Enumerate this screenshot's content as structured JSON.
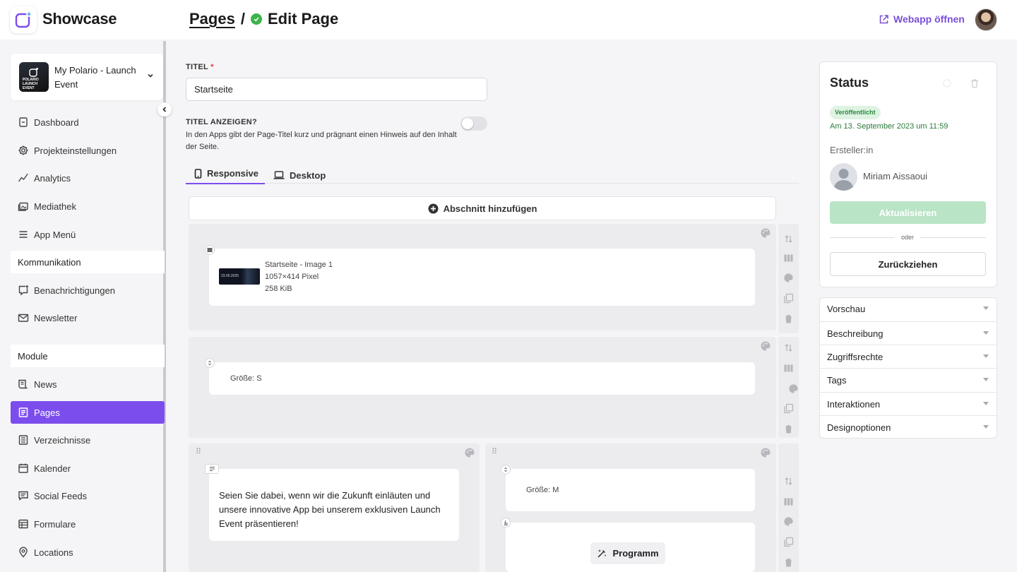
{
  "header": {
    "brand": "Showcase",
    "breadcrumb_link": "Pages",
    "breadcrumb_sep": "/",
    "breadcrumb_current": "Edit Page",
    "webapp_link": "Webapp öffnen"
  },
  "sidebar": {
    "project": {
      "name": "My Polario - Launch Event",
      "thumb_text": "POLARIO LAUNCH EVENT"
    },
    "items": [
      {
        "label": "Dashboard",
        "icon": "dashboard-icon"
      },
      {
        "label": "Projekteinstellungen",
        "icon": "gear-icon"
      },
      {
        "label": "Analytics",
        "icon": "analytics-icon"
      },
      {
        "label": "Mediathek",
        "icon": "media-library-icon"
      },
      {
        "label": "App Menü",
        "icon": "menu-icon"
      }
    ],
    "section_kommunikation": "Kommunikation",
    "items_kommunikation": [
      {
        "label": "Benachrichtigungen",
        "icon": "notification-icon"
      },
      {
        "label": "Newsletter",
        "icon": "mail-icon"
      }
    ],
    "section_module": "Module",
    "items_module": [
      {
        "label": "News",
        "icon": "news-icon"
      },
      {
        "label": "Pages",
        "icon": "page-icon",
        "active": true
      },
      {
        "label": "Verzeichnisse",
        "icon": "directory-icon"
      },
      {
        "label": "Kalender",
        "icon": "calendar-icon"
      },
      {
        "label": "Social Feeds",
        "icon": "social-feed-icon"
      },
      {
        "label": "Formulare",
        "icon": "form-icon"
      },
      {
        "label": "Locations",
        "icon": "location-pin-icon"
      }
    ]
  },
  "form": {
    "title_label": "TITEL",
    "title_required": "*",
    "title_value": "Startseite",
    "show_title_label": "TITEL ANZEIGEN?",
    "show_title_help": "In den Apps gibt der Page-Titel kurz und prägnant einen Hinweis auf den Inhalt der Seite.",
    "show_title_on": false
  },
  "tabs": [
    {
      "label": "Responsive",
      "icon": "phone-icon",
      "active": true
    },
    {
      "label": "Desktop",
      "icon": "laptop-icon",
      "active": false
    }
  ],
  "editor": {
    "add_section": "Abschnitt hinzufügen",
    "image_block": {
      "name": "Startseite - Image 1",
      "dimensions": "1057×414 Pixel",
      "size": "258 KiB",
      "thumb_text": "23.05.2025"
    },
    "spacer_s": "Größe: S",
    "text_block": "Seien Sie dabei, wenn wir die Zukunft einläuten und unsere innovative App bei unserem exklusiven Launch Event präsentieren!",
    "spacer_m": "Größe: M",
    "button_label": "Programm"
  },
  "status": {
    "title": "Status",
    "badge": "Veröffentlicht",
    "date": "Am 13. September 2023 um 11:59",
    "creator_label": "Ersteller:in",
    "creator_name": "Miriam Aissaoui",
    "update_button": "Aktualisieren",
    "or": "oder",
    "withdraw_button": "Zurückziehen"
  },
  "accordion": [
    "Vorschau",
    "Beschreibung",
    "Zugriffsrechte",
    "Tags",
    "Interaktionen",
    "Designoptionen"
  ],
  "colors": {
    "accent": "#7c4ded",
    "success": "#3bb44a",
    "update_disabled": "#b9e4c6"
  }
}
